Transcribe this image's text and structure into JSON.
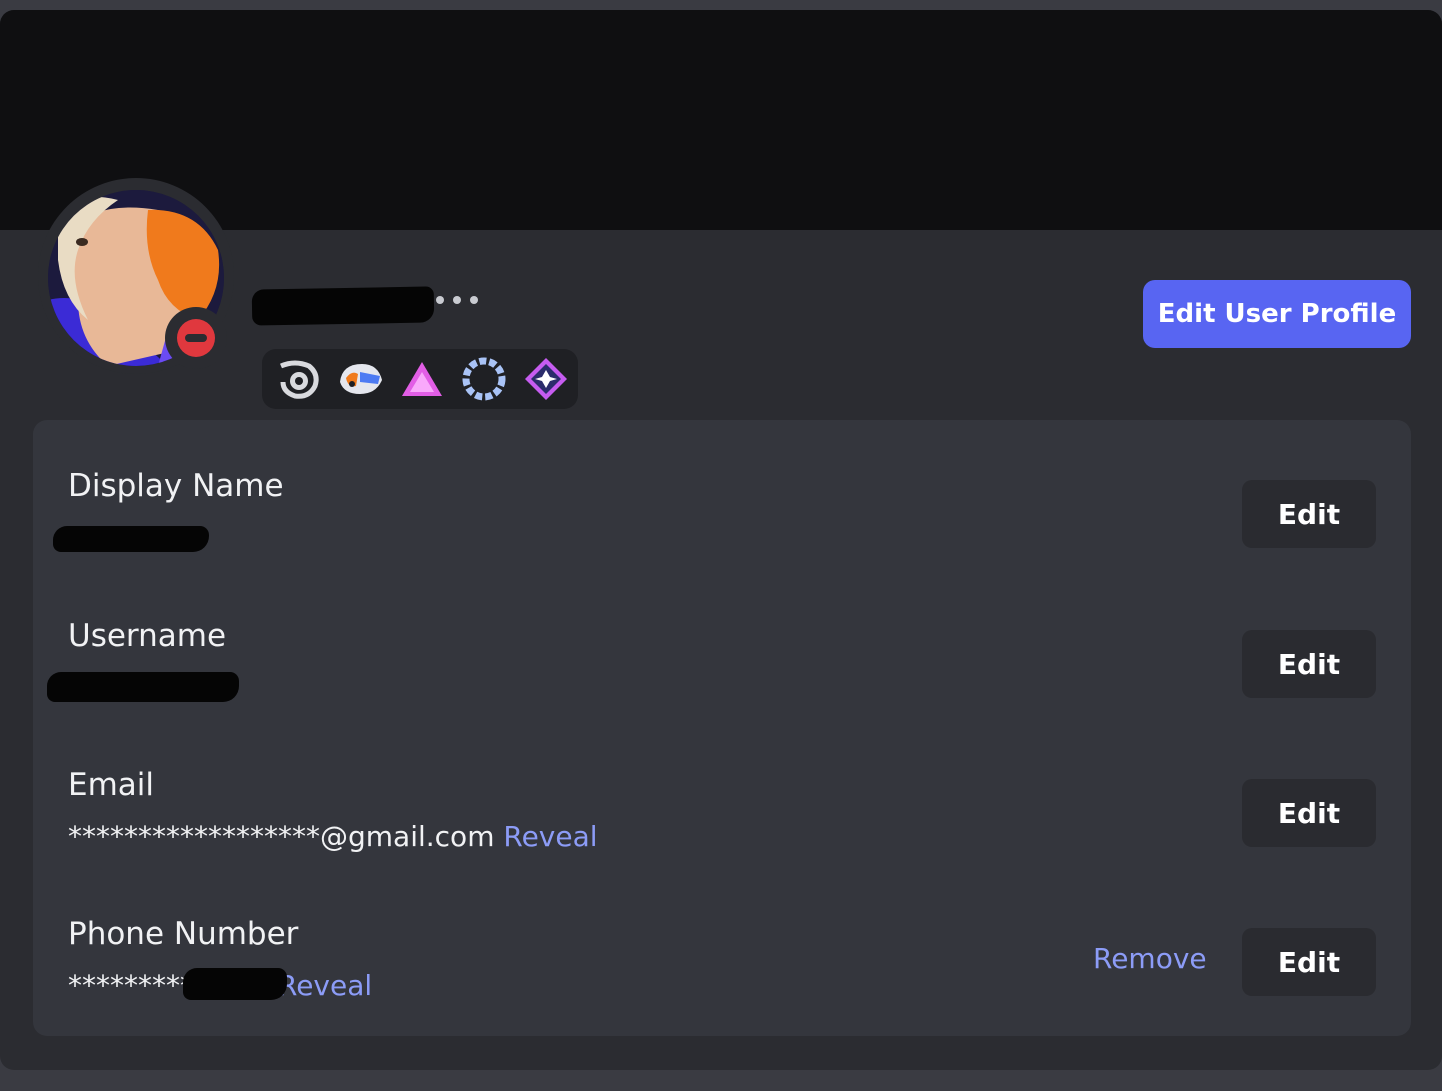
{
  "profile": {
    "edit_profile_label": "Edit User Profile",
    "status": "do-not-disturb",
    "badges": [
      {
        "icon": "hypesquad-swirl-icon"
      },
      {
        "icon": "quest-helmet-icon"
      },
      {
        "icon": "triangle-icon"
      },
      {
        "icon": "laurel-wreath-icon"
      },
      {
        "icon": "nitro-gem-icon"
      }
    ]
  },
  "account": {
    "display_name": {
      "label": "Display Name",
      "edit_label": "Edit"
    },
    "username": {
      "label": "Username",
      "edit_label": "Edit"
    },
    "email": {
      "label": "Email",
      "value": "******************@gmail.com",
      "reveal_label": "Reveal",
      "edit_label": "Edit"
    },
    "phone": {
      "label": "Phone Number",
      "value": "*********",
      "reveal_label": "Reveal",
      "remove_label": "Remove",
      "edit_label": "Edit"
    }
  },
  "colors": {
    "accent": "#5865f2",
    "link": "#8c9cf7",
    "dnd": "#e0383e"
  }
}
